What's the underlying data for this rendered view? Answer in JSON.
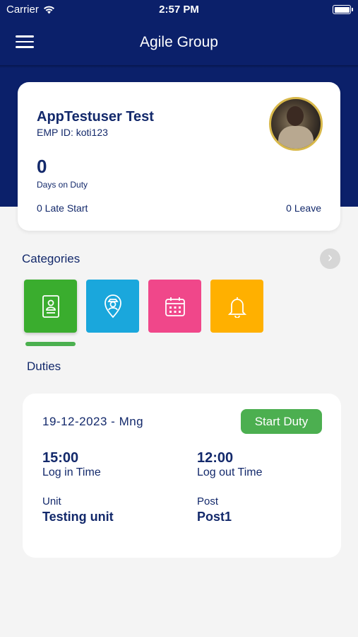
{
  "status_bar": {
    "carrier": "Carrier",
    "time": "2:57 PM"
  },
  "header": {
    "title": "Agile Group",
    "menu_icon": "hamburger-menu-icon"
  },
  "profile": {
    "name": "AppTestuser Test",
    "emp_id": "EMP ID: koti123",
    "days_on_duty": "0",
    "days_on_duty_label": "Days on Duty",
    "late_start": "0 Late Start",
    "leave": "0 Leave"
  },
  "categories": {
    "label": "Categories",
    "next_icon": "chevron-right-icon",
    "items": [
      {
        "icon": "id-card-icon",
        "color": "#3aad2e",
        "selected": true
      },
      {
        "icon": "guard-location-icon",
        "color": "#1aa7dc"
      },
      {
        "icon": "calendar-icon",
        "color": "#f0478a"
      },
      {
        "icon": "bell-icon",
        "color": "#ffb000"
      }
    ],
    "selected_label": "Duties"
  },
  "duty": {
    "date_shift": "19-12-2023 - Mng",
    "action_label": "Start Duty",
    "login_time": "15:00",
    "login_label": "Log in Time",
    "logout_time": "12:00",
    "logout_label": "Log out Time",
    "unit_label": "Unit",
    "unit_value": "Testing unit",
    "post_label": "Post",
    "post_value": "Post1"
  },
  "colors": {
    "primary": "#0b206a",
    "text": "#13296b",
    "success": "#4caf50",
    "background": "#f4f4f4"
  }
}
